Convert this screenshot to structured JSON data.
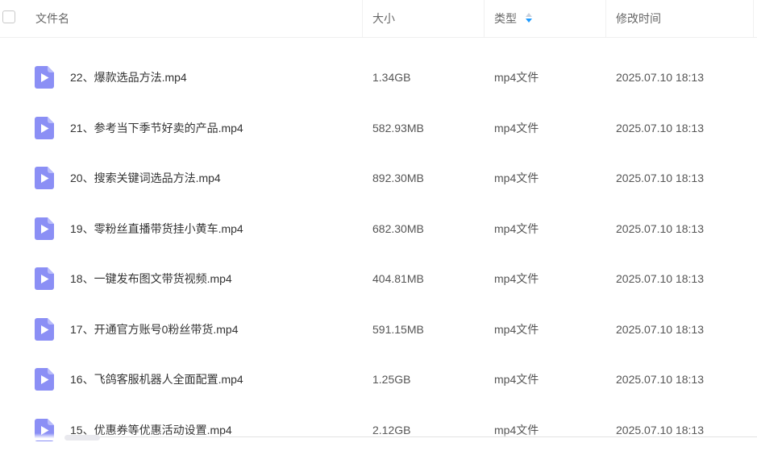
{
  "header": {
    "col_name": "文件名",
    "col_size": "大小",
    "col_type": "类型",
    "col_modified": "修改时间",
    "sort_icon": "sort-descending-icon"
  },
  "files": [
    {
      "name": "22、爆款选品方法.mp4",
      "size": "1.34GB",
      "type": "mp4文件",
      "modified": "2025.07.10 18:13"
    },
    {
      "name": "21、参考当下季节好卖的产品.mp4",
      "size": "582.93MB",
      "type": "mp4文件",
      "modified": "2025.07.10 18:13"
    },
    {
      "name": "20、搜索关键词选品方法.mp4",
      "size": "892.30MB",
      "type": "mp4文件",
      "modified": "2025.07.10 18:13"
    },
    {
      "name": "19、零粉丝直播带货挂小黄车.mp4",
      "size": "682.30MB",
      "type": "mp4文件",
      "modified": "2025.07.10 18:13"
    },
    {
      "name": "18、一键发布图文带货视频.mp4",
      "size": "404.81MB",
      "type": "mp4文件",
      "modified": "2025.07.10 18:13"
    },
    {
      "name": "17、开通官方账号0粉丝带货.mp4",
      "size": "591.15MB",
      "type": "mp4文件",
      "modified": "2025.07.10 18:13"
    },
    {
      "name": "16、飞鸽客服机器人全面配置.mp4",
      "size": "1.25GB",
      "type": "mp4文件",
      "modified": "2025.07.10 18:13"
    },
    {
      "name": "15、优惠券等优惠活动设置.mp4",
      "size": "2.12GB",
      "type": "mp4文件",
      "modified": "2025.07.10 18:13"
    }
  ],
  "colors": {
    "video_icon": "#8b8ff5",
    "sort_active": "#1e9bff"
  }
}
